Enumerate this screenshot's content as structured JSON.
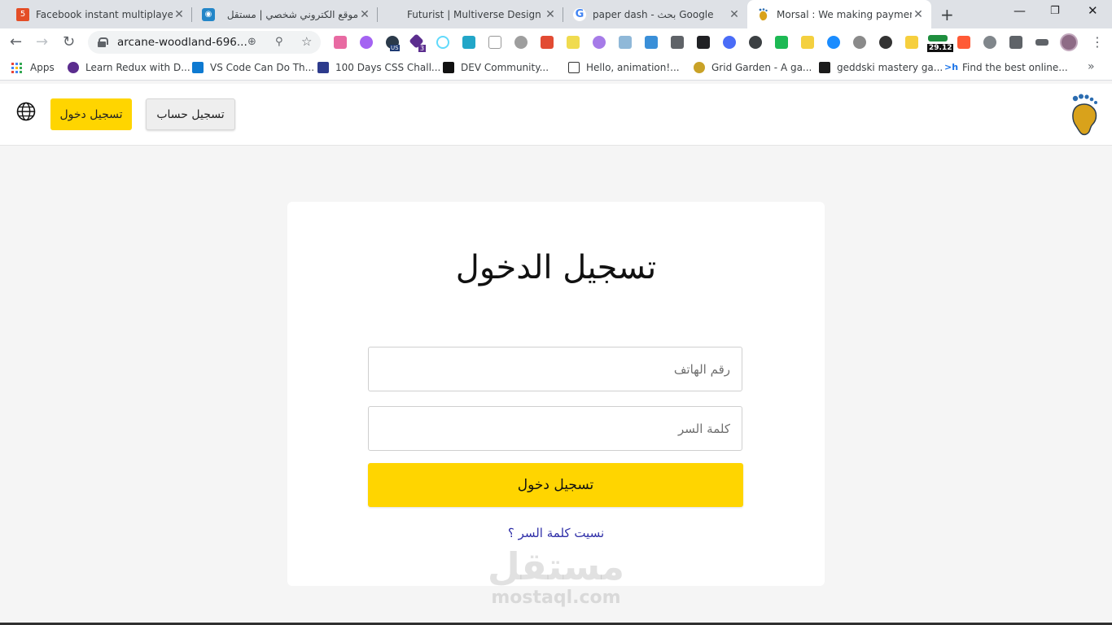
{
  "browser": {
    "tabs": [
      {
        "title": "Facebook instant multiplayer g",
        "icon": "html5-icon",
        "active": false
      },
      {
        "title": "موقع الكتروني شخصي | مستقل",
        "icon": "mostaql-icon",
        "active": false
      },
      {
        "title": "Futurist | Multiverse Design",
        "icon": "",
        "active": false
      },
      {
        "title": "paper dash - بحث Google",
        "icon": "google-icon",
        "active": false
      },
      {
        "title": "Morsal : We making payment e",
        "icon": "morsal-icon",
        "active": true
      }
    ],
    "address": "arcane-woodland-696...",
    "bookmarks": [
      {
        "label": "Apps"
      },
      {
        "label": "Learn Redux with D..."
      },
      {
        "label": "VS Code Can Do Th..."
      },
      {
        "label": "100 Days CSS Chall..."
      },
      {
        "label": "DEV Community..."
      },
      {
        "label": "Hello, animation!..."
      },
      {
        "label": "Grid Garden - A ga..."
      },
      {
        "label": "geddski mastery ga..."
      },
      {
        "label": "Find the best online..."
      }
    ],
    "extension_badges": {
      "us": "US",
      "three": "3",
      "counter": "29.12"
    }
  },
  "header": {
    "login_label": "تسجيل دخول",
    "register_label": "تسجيل حساب",
    "accent_color": "#FFD500"
  },
  "login": {
    "title": "تسجيل الدخول",
    "phone_placeholder": "رقم الهاتف",
    "password_placeholder": "كلمة السر",
    "submit_label": "تسجيل دخول",
    "forgot_label": "نسيت كلمة السر ؟"
  },
  "watermark": {
    "arabic": "مستقل",
    "latin": "mostaql.com"
  }
}
